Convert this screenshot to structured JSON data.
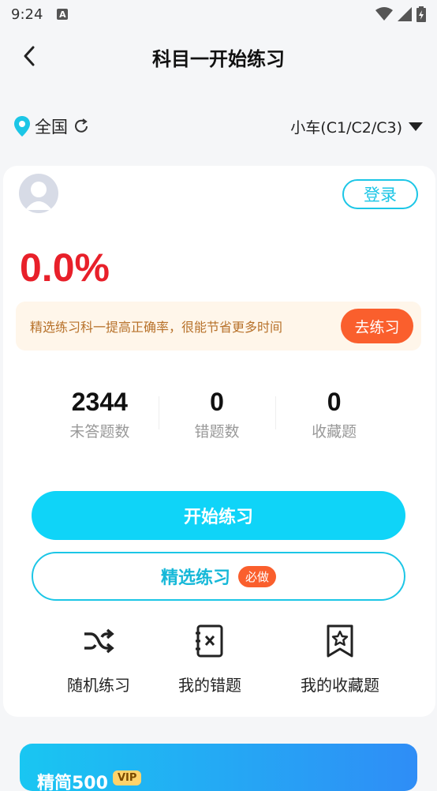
{
  "status_bar": {
    "time": "9:24",
    "indicator": "A"
  },
  "nav": {
    "back_icon": "chevron-left-icon",
    "title": "科目一开始练习"
  },
  "region": {
    "location": "全国",
    "location_icon": "location-pin-icon",
    "refresh_icon": "refresh-icon",
    "vehicle_type": "小车(C1/C2/C3)",
    "dropdown_icon": "caret-down-icon"
  },
  "card": {
    "login_label": "登录",
    "accuracy": "0.0%",
    "tip_text": "精选练习科一提高正确率，很能节省更多时间",
    "tip_button": "去练习",
    "stats": [
      {
        "value": "2344",
        "label": "未答题数"
      },
      {
        "value": "0",
        "label": "错题数"
      },
      {
        "value": "0",
        "label": "收藏题"
      }
    ],
    "start_button": "开始练习",
    "selected_button": "精选练习",
    "selected_badge": "必做",
    "actions": [
      {
        "label": "随机练习",
        "icon": "shuffle-icon"
      },
      {
        "label": "我的错题",
        "icon": "wrong-book-icon"
      },
      {
        "label": "我的收藏题",
        "icon": "bookmark-star-icon"
      }
    ]
  },
  "banner": {
    "text": "精简500",
    "tag": "VIP"
  },
  "colors": {
    "accent": "#0fd4f8",
    "accent_border": "#1cc6e6",
    "orange": "#fa5f2d",
    "accuracy_red": "#e8202a",
    "tip_bg": "#fff6ea"
  }
}
